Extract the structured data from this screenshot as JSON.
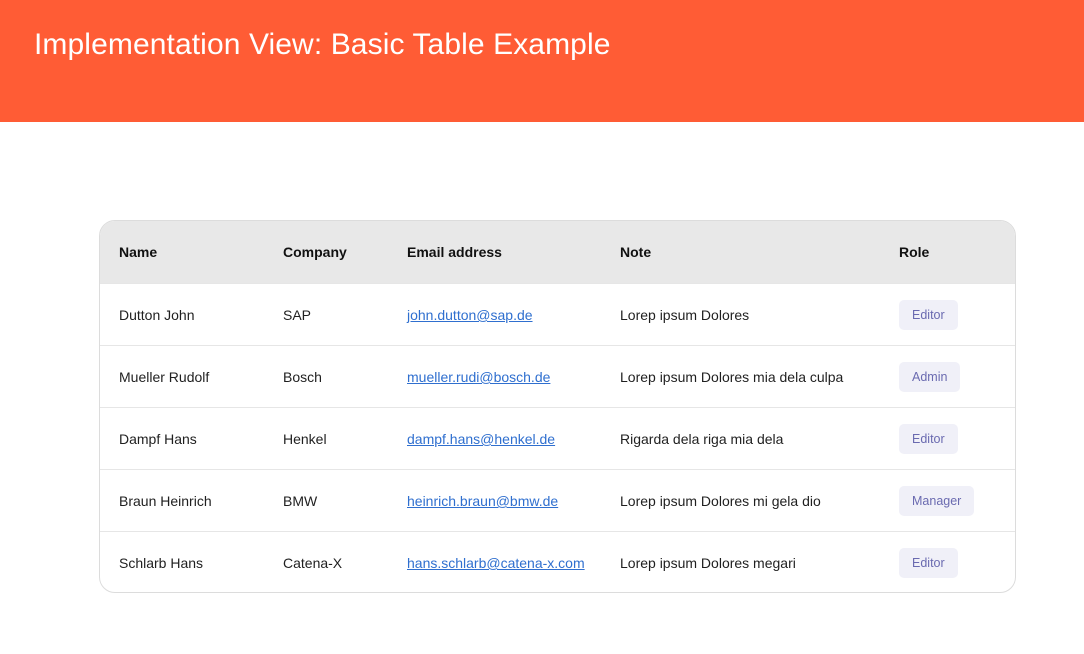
{
  "banner": {
    "title": "Implementation View: Basic Table Example",
    "background_color": "#ff5c35"
  },
  "table": {
    "headers": {
      "name": "Name",
      "company": "Company",
      "email": "Email address",
      "note": "Note",
      "role": "Role"
    },
    "rows": [
      {
        "name": "Dutton John",
        "company": "SAP",
        "email": "john.dutton@sap.de",
        "note": "Lorep ipsum Dolores",
        "role": "Editor"
      },
      {
        "name": "Mueller Rudolf",
        "company": "Bosch",
        "email": "mueller.rudi@bosch.de",
        "note": "Lorep ipsum Dolores mia dela culpa",
        "role": "Admin"
      },
      {
        "name": "Dampf Hans",
        "company": "Henkel",
        "email": "dampf.hans@henkel.de",
        "note": "Rigarda dela riga mia dela",
        "role": "Editor"
      },
      {
        "name": "Braun Heinrich",
        "company": "BMW",
        "email": "heinrich.braun@bmw.de",
        "note": "Lorep ipsum Dolores mi gela dio",
        "role": "Manager"
      },
      {
        "name": "Schlarb Hans",
        "company": "Catena-X",
        "email": "hans.schlarb@catena-x.com",
        "note": "Lorep ipsum Dolores megari",
        "role": "Editor"
      }
    ],
    "link_color": "#2f6fcf",
    "badge_color": "#6a6ab0"
  }
}
